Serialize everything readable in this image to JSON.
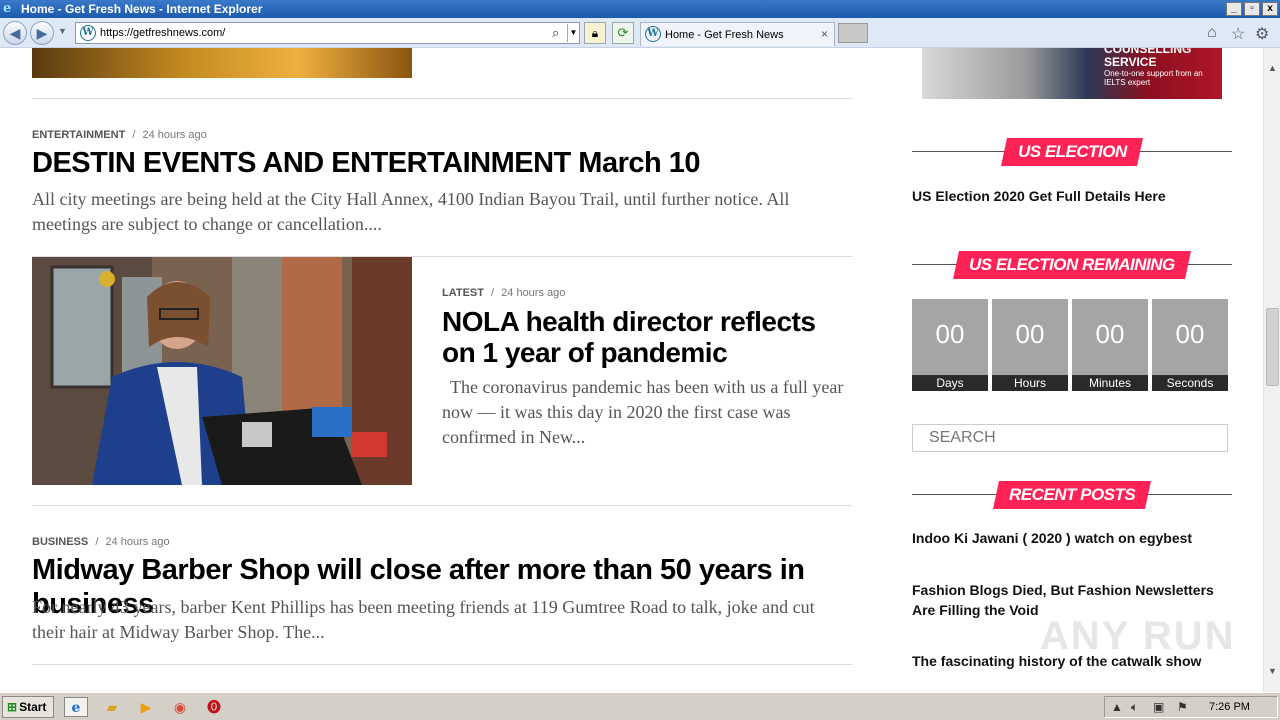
{
  "window": {
    "title": "Home - Get Fresh News - Internet Explorer",
    "min_glyph": "_",
    "max_glyph": "▫",
    "close_glyph": "x"
  },
  "browser": {
    "url": "https://getfreshnews.com/",
    "tab_title": "Home - Get Fresh News",
    "tab_close": "×",
    "icons": [
      "back-icon",
      "forward-icon",
      "search-icon",
      "lock-icon",
      "refresh-icon",
      "home-icon",
      "star-icon",
      "gear-icon"
    ]
  },
  "articles": [
    {
      "category": "ENTERTAINMENT",
      "time": "24 hours ago",
      "title": "DESTIN EVENTS AND ENTERTAINMENT March 10",
      "excerpt": "All city meetings are being held at the City Hall Annex, 4100 Indian Bayou Trail, until further notice. All meetings are subject to change or cancellation...."
    },
    {
      "category": "LATEST",
      "time": "24 hours ago",
      "title": "NOLA health director reflects on 1 year of pandemic",
      "excerpt": "The coronavirus pandemic has been with us a full year now — it was this day in 2020 the first case was confirmed in New..."
    },
    {
      "category": "BUSINESS",
      "time": "24 hours ago",
      "title": "Midway Barber Shop will close after more than 50 years in business",
      "excerpt": "For nearly 43 years, barber Kent Phillips has been meeting friends at 119 Gumtree Road to talk, joke and cut their hair at Midway Barber Shop. The..."
    }
  ],
  "meta_separator": "/",
  "sidebar": {
    "ad": {
      "title": "COUNSELLING SERVICE",
      "subtitle": "One-to-one support from an IELTS expert"
    },
    "us_election": {
      "heading": "US ELECTION",
      "link": "US Election 2020 Get Full Details Here"
    },
    "remaining": {
      "heading": "US ELECTION REMAINING",
      "units": [
        {
          "value": "00",
          "label": "Days"
        },
        {
          "value": "00",
          "label": "Hours"
        },
        {
          "value": "00",
          "label": "Minutes"
        },
        {
          "value": "00",
          "label": "Seconds"
        }
      ]
    },
    "search_placeholder": "SEARCH",
    "recent_posts": {
      "heading": "RECENT POSTS",
      "items": [
        "Indoo Ki Jawani ( 2020 ) watch on egybest",
        "Fashion Blogs Died, But Fashion Newsletters Are Filling the Void",
        "The fascinating history of the catwalk show"
      ]
    },
    "watermark": "ANY RUN"
  },
  "taskbar": {
    "start_label": "Start",
    "clock": "7:26 PM"
  },
  "colors": {
    "accent": "#ff2257",
    "titlebar": "#1c5aae"
  }
}
